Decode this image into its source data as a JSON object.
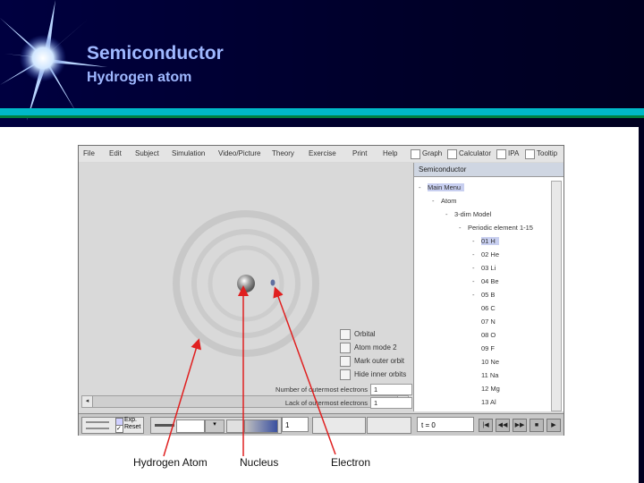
{
  "slide": {
    "title": "Semiconductor",
    "subtitle": "Hydrogen atom"
  },
  "menu": [
    "File",
    "Edit",
    "Subject",
    "Simulation",
    "Video/Picture",
    "Theory",
    "Exercise",
    "Print",
    "Help"
  ],
  "menu_checks": [
    "Graph",
    "Calculator",
    "IPA",
    "Tooltip"
  ],
  "panel": {
    "header": "Semiconductor",
    "tree": [
      {
        "label": "Main Menu",
        "indent": 0,
        "expander": "-",
        "selected": true
      },
      {
        "label": "Atom",
        "indent": 1,
        "expander": "-",
        "selected": false
      },
      {
        "label": "3-dim Model",
        "indent": 2,
        "expander": "-",
        "selected": false
      },
      {
        "label": "Periodic element 1-15",
        "indent": 3,
        "expander": "-",
        "selected": false
      },
      {
        "label": "01 H",
        "indent": 4,
        "expander": "-",
        "selected": true
      },
      {
        "label": "02 He",
        "indent": 4,
        "expander": "-",
        "selected": false
      },
      {
        "label": "03 Li",
        "indent": 4,
        "expander": "-",
        "selected": false
      },
      {
        "label": "04 Be",
        "indent": 4,
        "expander": "-",
        "selected": false
      },
      {
        "label": "05 B",
        "indent": 4,
        "expander": "-",
        "selected": false
      },
      {
        "label": "06 C",
        "indent": 4,
        "expander": "",
        "selected": false
      },
      {
        "label": "07 N",
        "indent": 4,
        "expander": "",
        "selected": false
      },
      {
        "label": "08 O",
        "indent": 4,
        "expander": "",
        "selected": false
      },
      {
        "label": "09 F",
        "indent": 4,
        "expander": "",
        "selected": false
      },
      {
        "label": "10 Ne",
        "indent": 4,
        "expander": "",
        "selected": false
      },
      {
        "label": "11 Na",
        "indent": 4,
        "expander": "",
        "selected": false
      },
      {
        "label": "12 Mg",
        "indent": 4,
        "expander": "",
        "selected": false
      },
      {
        "label": "13 Al",
        "indent": 4,
        "expander": "",
        "selected": false
      }
    ]
  },
  "options": [
    "Orbital",
    "Atom mode 2",
    "Mark outer orbit",
    "Hide inner orbits"
  ],
  "fields": [
    {
      "label": "Number of outermost electrons",
      "value": "1"
    },
    {
      "label": "Lack of outermost electrons",
      "value": "1"
    }
  ],
  "bottom": {
    "legend_top": "Exp.",
    "legend_bottom": "Reset",
    "zoom_value": "1",
    "time": "t = 0",
    "media_buttons": [
      "|◀",
      "◀◀",
      "▶▶",
      "■",
      "▶"
    ]
  },
  "callouts": {
    "hydrogen_atom": "Hydrogen Atom",
    "nucleus": "Nucleus",
    "electron": "Electron"
  },
  "colors": {
    "title": "#9fb8ff",
    "accent_bar": "#00b8c8",
    "arrows": "#e02020"
  }
}
